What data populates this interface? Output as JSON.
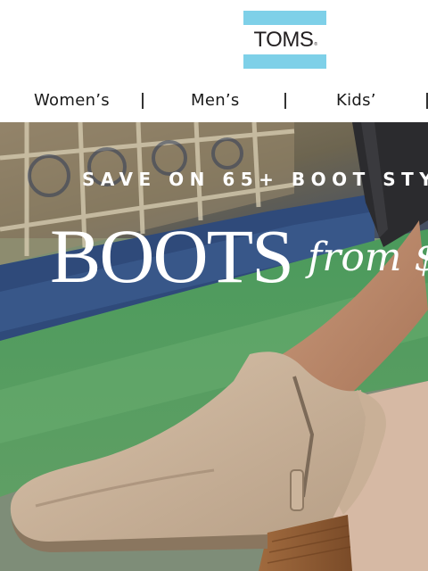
{
  "header": {
    "logo_text": "TOMS",
    "logo_mark": "®",
    "brand_colors": {
      "accent": "#7ed0e8",
      "text": "#231f20"
    }
  },
  "nav": {
    "items": [
      {
        "label": "Women’s"
      },
      {
        "label": "Men’s"
      },
      {
        "label": "Kids’"
      }
    ]
  },
  "hero": {
    "subheadline": "SAVE ON 65+ BOOT STY",
    "headline": "BOOTS",
    "price_lead": "from $",
    "image": "tan suede wedge bootie worn with dark jeans"
  }
}
